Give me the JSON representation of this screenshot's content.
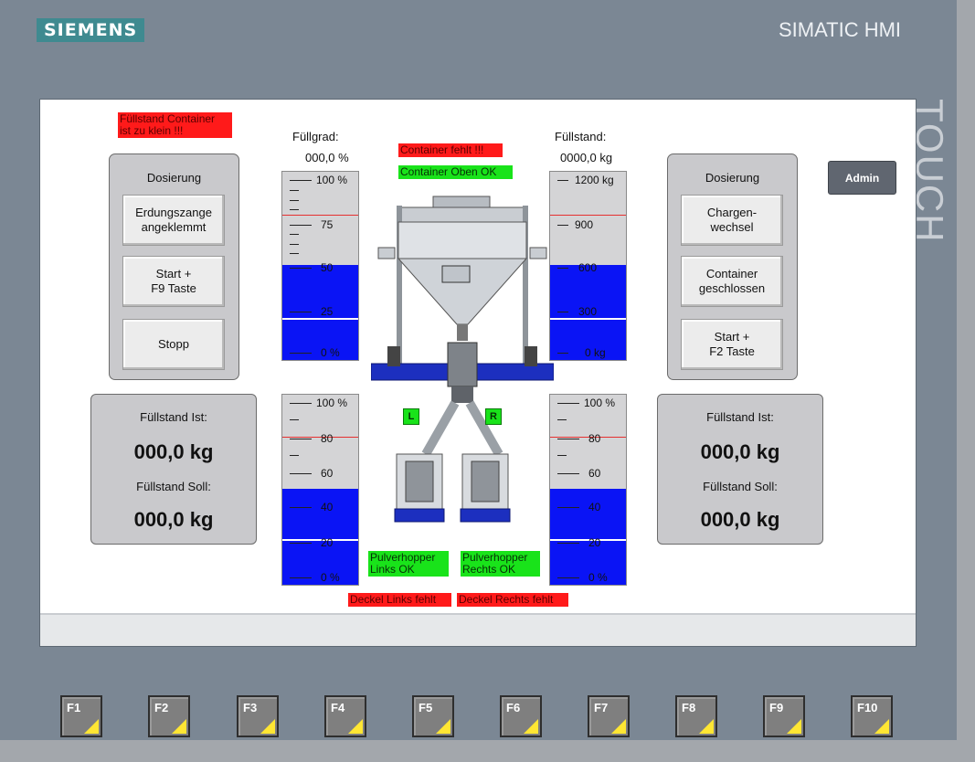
{
  "device": {
    "brand": "SIEMENS",
    "product": "SIMATIC HMI",
    "touch_label": "TOUCH"
  },
  "alarms": {
    "container_small": "Füllstand Container\nist zu klein !!!",
    "container_missing": "Container fehlt !!!",
    "lid_left": "Deckel Links fehlt",
    "lid_right": "Deckel Rechts fehlt"
  },
  "ok_status": {
    "container_top": "Container Oben OK",
    "hopper_left": "Pulverhopper\nLinks OK",
    "hopper_right": "Pulverhopper\nRechts OK"
  },
  "left_dosing": {
    "title": "Dosierung",
    "buttons": [
      "Erdungszange\nangeklemmt",
      "Start +\nF9 Taste",
      "Stopp"
    ]
  },
  "right_dosing": {
    "title": "Dosierung",
    "buttons": [
      "Chargen-\nwechsel",
      "Container\ngeschlossen",
      "Start +\nF2 Taste"
    ]
  },
  "left_fill": {
    "ist_label": "Füllstand Ist:",
    "ist_value": "000,0 kg",
    "soll_label": "Füllstand Soll:",
    "soll_value": "000,0 kg"
  },
  "right_fill": {
    "ist_label": "Füllstand Ist:",
    "ist_value": "000,0 kg",
    "soll_label": "Füllstand Soll:",
    "soll_value": "000,0 kg"
  },
  "fuellgrad": {
    "label": "Füllgrad:",
    "value": "000,0 %",
    "ticks": [
      "100 %",
      "75",
      "50",
      "25",
      "0 %"
    ],
    "level_percent": 50
  },
  "fuellstand": {
    "label": "Füllstand:",
    "value": "0000,0 kg",
    "ticks": [
      "1200 kg",
      "900",
      "600",
      "300",
      "0 kg"
    ],
    "level_percent": 50
  },
  "lower_gauge_left": {
    "ticks": [
      "100 %",
      "80",
      "60",
      "40",
      "20",
      "0 %"
    ],
    "level_percent": 50
  },
  "lower_gauge_right": {
    "ticks": [
      "100 %",
      "80",
      "60",
      "40",
      "20",
      "0 %"
    ],
    "level_percent": 50
  },
  "markers": {
    "left": "L",
    "right": "R"
  },
  "admin_button": "Admin",
  "function_keys": [
    "F1",
    "F2",
    "F3",
    "F4",
    "F5",
    "F6",
    "F7",
    "F8",
    "F9",
    "F10"
  ],
  "colors": {
    "alarm": "#ff1a1a",
    "ok": "#19e31a",
    "fill": "#0a14f5",
    "bezel": "#7b8794"
  }
}
